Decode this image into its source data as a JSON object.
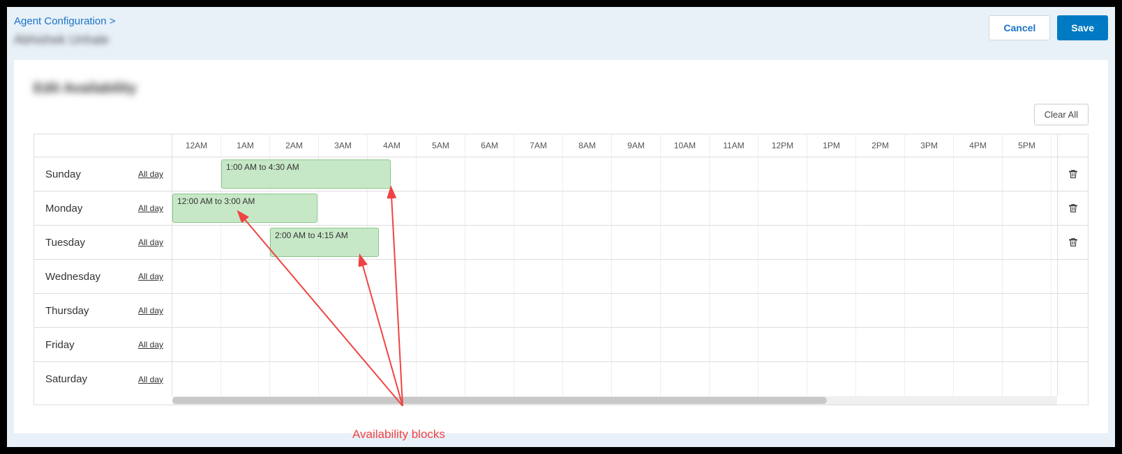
{
  "breadcrumb": {
    "link": "Agent Configuration >",
    "subtitle": "Abhishek Unhale"
  },
  "buttons": {
    "cancel": "Cancel",
    "save": "Save",
    "clear_all": "Clear All"
  },
  "panel": {
    "title": "Edit Availability"
  },
  "hours": [
    "12AM",
    "1AM",
    "2AM",
    "3AM",
    "4AM",
    "5AM",
    "6AM",
    "7AM",
    "8AM",
    "9AM",
    "10AM",
    "11AM",
    "12PM",
    "1PM",
    "2PM",
    "3PM",
    "4PM",
    "5PM"
  ],
  "all_day_label": "All day",
  "days": [
    {
      "name": "Sunday",
      "blocks": [
        {
          "label": "1:00 AM to 4:30 AM",
          "start_hr": 1.0,
          "end_hr": 4.5
        }
      ],
      "trash": true
    },
    {
      "name": "Monday",
      "blocks": [
        {
          "label": "12:00 AM to 3:00 AM",
          "start_hr": 0.0,
          "end_hr": 3.0
        }
      ],
      "trash": true
    },
    {
      "name": "Tuesday",
      "blocks": [
        {
          "label": "2:00 AM to 4:15 AM",
          "start_hr": 2.0,
          "end_hr": 4.25
        }
      ],
      "trash": true
    },
    {
      "name": "Wednesday",
      "blocks": [],
      "trash": false
    },
    {
      "name": "Thursday",
      "blocks": [],
      "trash": false
    },
    {
      "name": "Friday",
      "blocks": [],
      "trash": false
    },
    {
      "name": "Saturday",
      "blocks": [],
      "trash": false
    }
  ],
  "annotation": {
    "label": "Availability blocks"
  }
}
